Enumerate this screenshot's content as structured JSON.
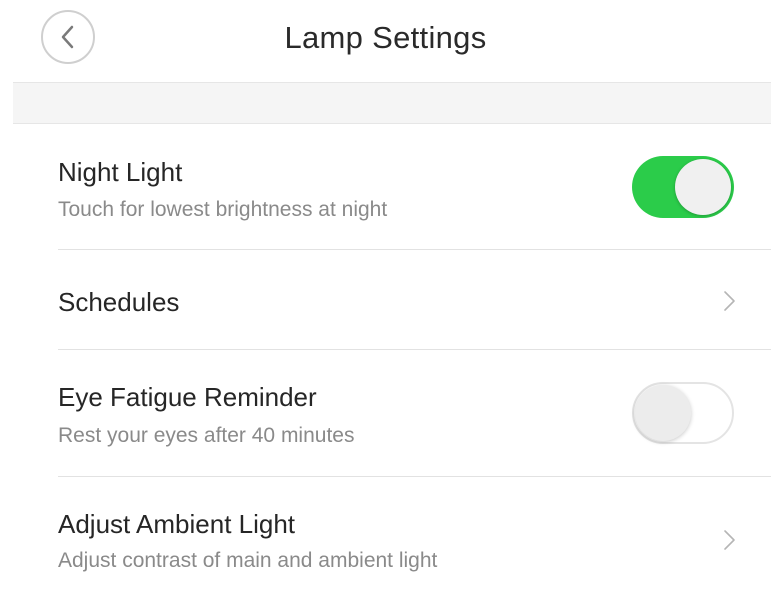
{
  "header": {
    "title": "Lamp Settings",
    "back_icon": "chevron-left-icon"
  },
  "settings": [
    {
      "label": "Night Light",
      "subtitle": "Touch for lowest brightness at night",
      "control": "toggle",
      "enabled": true
    },
    {
      "label": "Schedules",
      "control": "chevron",
      "icon": "chevron-right-icon"
    },
    {
      "label": "Eye Fatigue Reminder",
      "subtitle": "Rest your eyes after 40 minutes",
      "control": "toggle",
      "enabled": false
    },
    {
      "label": "Adjust Ambient Light",
      "subtitle": "Adjust contrast of main and ambient light",
      "control": "chevron",
      "icon": "chevron-right-icon"
    }
  ],
  "colors": {
    "toggle_on": "#2bcc4a",
    "toggle_off_border": "#e4e4e4",
    "subtitle": "#8a8a8a",
    "band": "#f5f5f5"
  }
}
